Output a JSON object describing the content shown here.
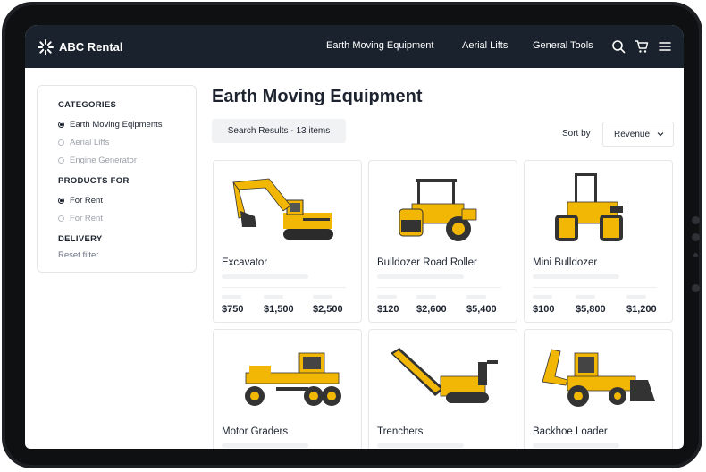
{
  "header": {
    "brand": "ABC Rental",
    "logo_icon": "sunburst-logo",
    "nav": [
      "Earth Moving Equipment",
      "Aerial Lifts",
      "General Tools"
    ],
    "icons": [
      "search-icon",
      "cart-icon",
      "menu-icon"
    ]
  },
  "sidebar": {
    "categories_title": "CATEGORIES",
    "categories": [
      {
        "label": "Earth Moving Eqipments",
        "selected": true
      },
      {
        "label": "Aerial Lifts",
        "selected": false
      },
      {
        "label": "Engine Generator",
        "selected": false
      }
    ],
    "products_title": "PRODUCTS FOR",
    "products": [
      {
        "label": "For Rent",
        "selected": true
      },
      {
        "label": "For Rent",
        "selected": false
      }
    ],
    "delivery_title": "DELIVERY",
    "reset": "Reset filter"
  },
  "main": {
    "title": "Earth Moving Equipment",
    "results": "Search Results - 13 items",
    "sort_label": "Sort by",
    "sort_value": "Revenue"
  },
  "products": [
    {
      "name": "Excavator",
      "prices": [
        "$750",
        "$1,500",
        "$2,500"
      ]
    },
    {
      "name": "Bulldozer Road Roller",
      "prices": [
        "$120",
        "$2,600",
        "$5,400"
      ]
    },
    {
      "name": "Mini Bulldozer",
      "prices": [
        "$100",
        "$5,800",
        "$1,200"
      ]
    },
    {
      "name": "Motor Graders",
      "prices": []
    },
    {
      "name": "Trenchers",
      "prices": []
    },
    {
      "name": "Backhoe Loader",
      "prices": []
    }
  ],
  "colors": {
    "topbar": "#1a232d",
    "machine_yellow": "#f2b705",
    "text": "#1d2430"
  }
}
